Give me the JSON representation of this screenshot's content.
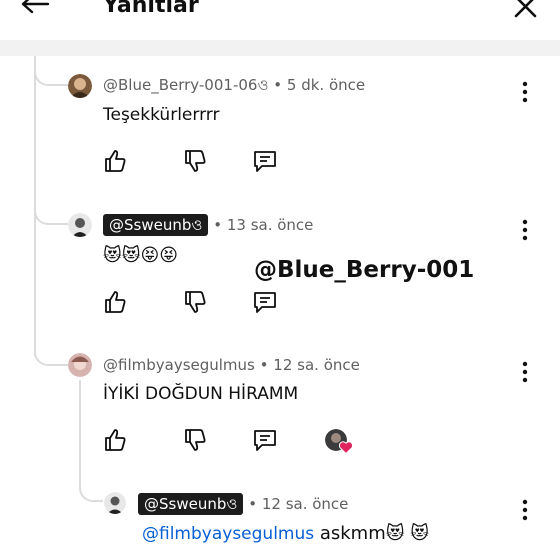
{
  "header": {
    "title": "Yanıtlar"
  },
  "comments": [
    {
      "author": "@Blue_Berry-001-06ও",
      "time": "5 dk. önce",
      "text": "Teşekkürlerrrr"
    },
    {
      "author": "@Ssweunbও",
      "time": "13 sa. önce",
      "text": "😻😻😝😝"
    },
    {
      "author": "@filmbyaysegulmus",
      "time": "12 sa. önce",
      "text": "İYİKİ DOĞDUN HİRAMM"
    },
    {
      "author": "@Ssweunbও",
      "time": "12 sa. önce",
      "mention": "@filmbyaysegulmus",
      "text": " askmm😻 😻"
    }
  ],
  "overlay": {
    "text": "@Blue_Berry-001"
  },
  "separator": "•",
  "colors": {
    "link": "#065fd4",
    "badge": "#1c1c1c",
    "meta": "#606060",
    "heart": "#e0245e"
  },
  "icons": [
    "back-arrow-icon",
    "close-icon",
    "thumbs-up-icon",
    "thumbs-down-icon",
    "reply-icon",
    "more-vertical-icon",
    "heart-icon"
  ]
}
